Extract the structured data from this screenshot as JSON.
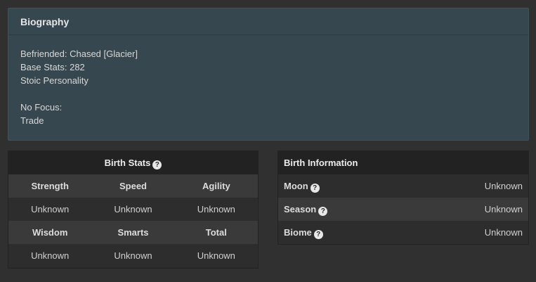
{
  "biography": {
    "title": "Biography",
    "lines": [
      "Befriended: Chased [Glacier]",
      "Base Stats: 282",
      "Stoic Personality"
    ],
    "focus_label": "No Focus:",
    "focus_value": "Trade"
  },
  "birth_stats": {
    "title": "Birth Stats",
    "row1_labels": [
      "Strength",
      "Speed",
      "Agility"
    ],
    "row1_values": [
      "Unknown",
      "Unknown",
      "Unknown"
    ],
    "row2_labels": [
      "Wisdom",
      "Smarts",
      "Total"
    ],
    "row2_values": [
      "Unknown",
      "Unknown",
      "Unknown"
    ]
  },
  "birth_info": {
    "title": "Birth Information",
    "rows": [
      {
        "label": "Moon",
        "value": "Unknown"
      },
      {
        "label": "Season",
        "value": "Unknown"
      },
      {
        "label": "Biome",
        "value": "Unknown"
      }
    ]
  },
  "icons": {
    "help": "?"
  }
}
